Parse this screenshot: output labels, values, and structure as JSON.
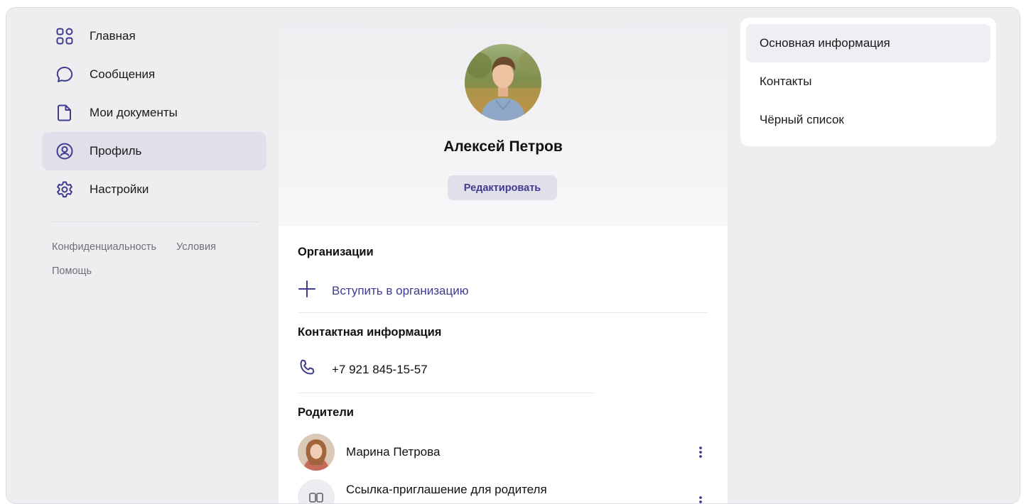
{
  "sidebar": {
    "items": [
      {
        "label": "Главная",
        "icon": "home-grid-icon",
        "active": false
      },
      {
        "label": "Сообщения",
        "icon": "message-bubble-icon",
        "active": false
      },
      {
        "label": "Мои документы",
        "icon": "document-icon",
        "active": false
      },
      {
        "label": "Профиль",
        "icon": "user-circle-icon",
        "active": true
      },
      {
        "label": "Настройки",
        "icon": "gear-icon",
        "active": false
      }
    ],
    "footer": {
      "privacy": "Конфиденциальность",
      "terms": "Условия",
      "help": "Помощь"
    }
  },
  "profile": {
    "name": "Алексей Петров",
    "edit_label": "Редактировать",
    "sections": {
      "organizations": {
        "title": "Организации",
        "join_label": "Вступить в организацию"
      },
      "contact": {
        "title": "Контактная информация",
        "phone": "+7 921 845-15-57"
      },
      "parents": {
        "title": "Родители",
        "items": [
          {
            "name": "Марина Петрова"
          },
          {
            "name": "Ссылка-приглашение для родителя"
          }
        ]
      }
    }
  },
  "right_menu": {
    "items": [
      {
        "label": "Основная информация",
        "active": true
      },
      {
        "label": "Контакты",
        "active": false
      },
      {
        "label": "Чёрный список",
        "active": false
      }
    ]
  },
  "colors": {
    "accent": "#3f3c8f",
    "active_bg": "#e1e0ea",
    "page_bg": "#eeeef1"
  }
}
